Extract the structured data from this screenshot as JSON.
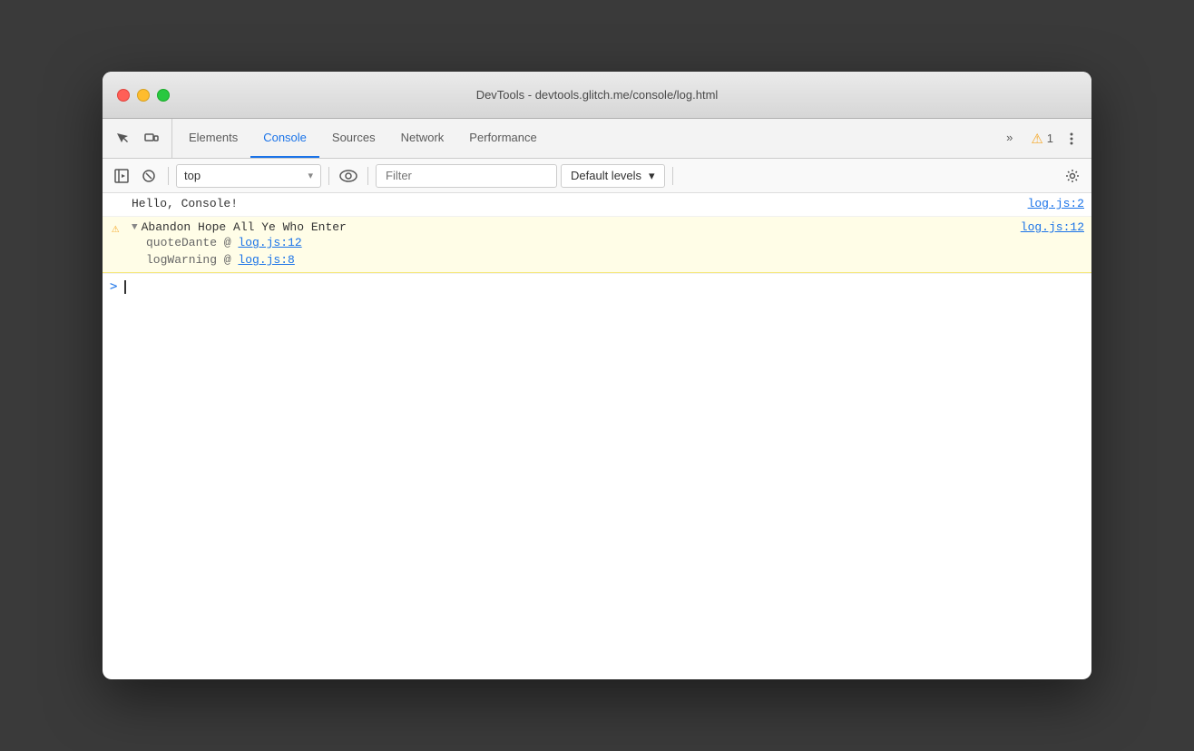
{
  "window": {
    "title": "DevTools - devtools.glitch.me/console/log.html"
  },
  "tabs": {
    "items": [
      {
        "id": "elements",
        "label": "Elements",
        "active": false
      },
      {
        "id": "console",
        "label": "Console",
        "active": true
      },
      {
        "id": "sources",
        "label": "Sources",
        "active": false
      },
      {
        "id": "network",
        "label": "Network",
        "active": false
      },
      {
        "id": "performance",
        "label": "Performance",
        "active": false
      }
    ],
    "more_label": "»",
    "warning_count": "1"
  },
  "toolbar": {
    "context_value": "top",
    "context_placeholder": "top",
    "filter_placeholder": "Filter",
    "levels_label": "Default levels",
    "levels_arrow": "▾"
  },
  "console": {
    "entries": [
      {
        "type": "info",
        "text": "Hello, Console!",
        "source": "log.js:2"
      },
      {
        "type": "warning",
        "text": "Abandon Hope All Ye Who Enter",
        "source": "log.js:12",
        "stack": [
          {
            "fn": "quoteDante",
            "link": "log.js:12"
          },
          {
            "fn": "logWarning",
            "link": "log.js:8"
          }
        ]
      }
    ],
    "prompt_symbol": ">"
  }
}
